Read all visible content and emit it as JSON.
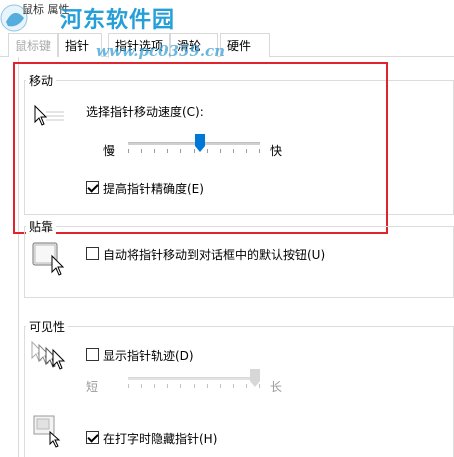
{
  "window": {
    "title": "鼠标 属性"
  },
  "watermark": {
    "name": "河东软件园",
    "url": "www.pc0359.cn"
  },
  "tabs": [
    {
      "label": "鼠标键",
      "selected": false
    },
    {
      "label": "指针",
      "selected": false
    },
    {
      "label": "指针选项",
      "selected": true
    },
    {
      "label": "滑轮",
      "selected": false
    },
    {
      "label": "硬件",
      "selected": false
    }
  ],
  "motion": {
    "legend": "移动",
    "speed_label": "选择指针移动速度(C):",
    "slow_label": "慢",
    "fast_label": "快",
    "speed_value": 0.55,
    "precision_label": "提高指针精确度(E)",
    "precision_checked": true
  },
  "snap": {
    "legend": "贴靠",
    "snap_label": "自动将指针移动到对话框中的默认按钮(U)",
    "snap_checked": false
  },
  "visibility": {
    "legend": "可见性",
    "trails_label": "显示指针轨迹(D)",
    "trails_checked": false,
    "short_label": "短",
    "long_label": "长",
    "trail_value": 1.0,
    "hide_label": "在打字时隐藏指针(H)",
    "hide_checked": true
  },
  "colors": {
    "highlight": "#e0242e",
    "watermark": "#1a9ad6",
    "accent": "#0078d7"
  }
}
